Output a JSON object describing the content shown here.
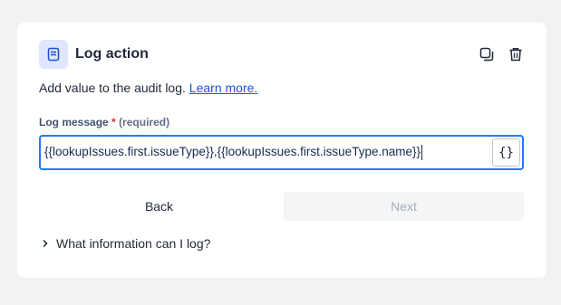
{
  "panel": {
    "title": "Log action",
    "description": "Add value to the audit log.",
    "learn_more": "Learn more.",
    "icons": {
      "header": "log-document-icon",
      "duplicate": "duplicate-icon",
      "delete": "trash-icon"
    }
  },
  "field": {
    "label": "Log message",
    "required_star": "*",
    "required_text": "(required)",
    "value": "{{lookupIssues.first.issueType}},{{lookupIssues.first.issueType.name}}",
    "smart_value_button": "{}"
  },
  "buttons": {
    "back": "Back",
    "next": "Next"
  },
  "expander": {
    "label": "What information can I log?"
  },
  "colors": {
    "accent": "#1d7afc",
    "link": "#1558d6",
    "required": "#c9372c"
  }
}
